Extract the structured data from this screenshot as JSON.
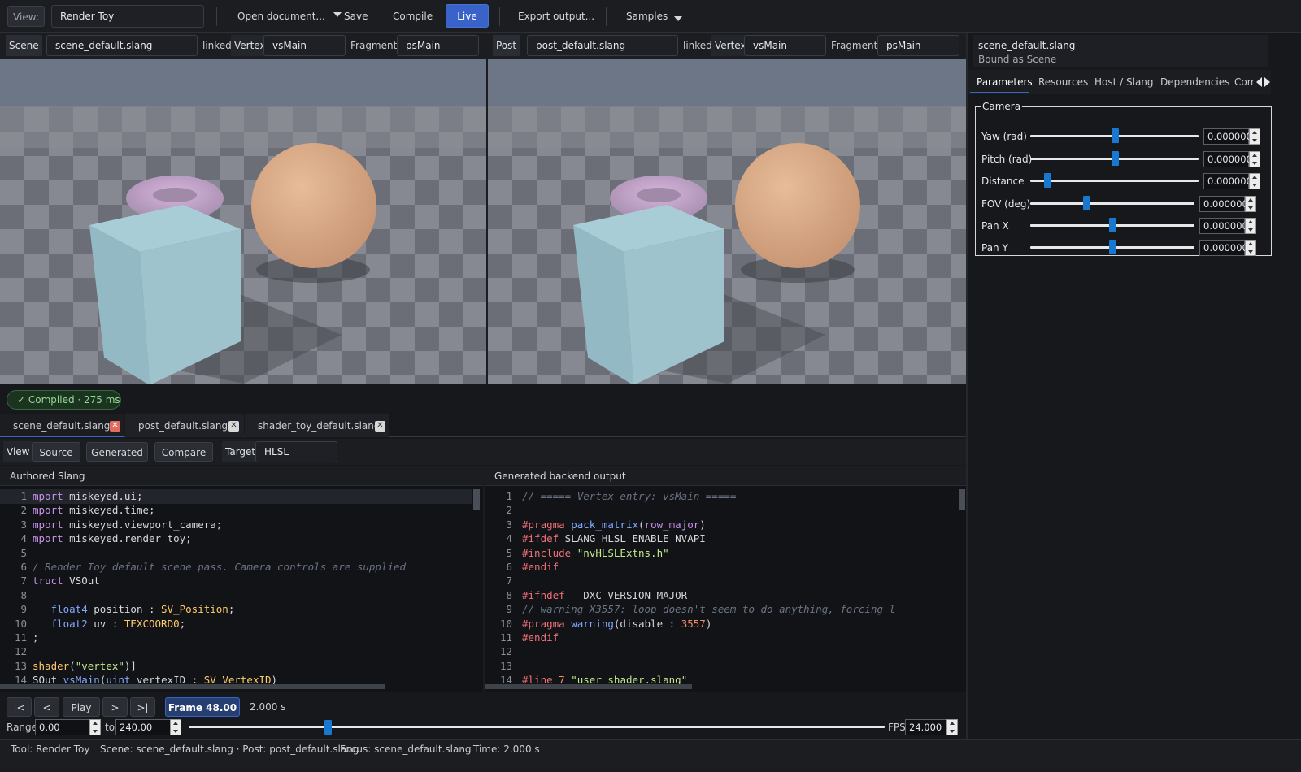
{
  "toolbar": {
    "view_label": "View:",
    "view_value": "Render Toy",
    "open_document": "Open document...",
    "save": "Save",
    "compile": "Compile",
    "live": "Live",
    "export_output": "Export output...",
    "samples": "Samples"
  },
  "scene_bar": {
    "tag": "Scene",
    "file": "scene_default.slang",
    "linked": "linked",
    "vertex_label": "Vertex",
    "vertex_value": "vsMain",
    "fragment_label": "Fragment",
    "fragment_value": "psMain"
  },
  "post_bar": {
    "tag": "Post",
    "file": "post_default.slang",
    "linked": "linked",
    "vertex_label": "Vertex",
    "vertex_value": "vsMain",
    "fragment_label": "Fragment",
    "fragment_value": "psMain"
  },
  "status_badge": "✓  Compiled · 275 ms",
  "doc_tabs": [
    {
      "label": "scene_default.slang",
      "active": true
    },
    {
      "label": "post_default.slang",
      "active": false
    },
    {
      "label": "shader_toy_default.slang",
      "active": false
    }
  ],
  "view_bar": {
    "view_label": "View",
    "source": "Source",
    "generated": "Generated",
    "compare": "Compare",
    "target_label": "Target",
    "target_value": "HLSL"
  },
  "left_pane_title": "Authored Slang",
  "right_pane_title": "Generated backend output",
  "left_line_numbers": [
    "1",
    "2",
    "3",
    "4",
    "5",
    "6",
    "7",
    "8",
    "9",
    "10",
    "11",
    "12",
    "13",
    "14"
  ],
  "right_line_numbers": [
    "1",
    "2",
    "3",
    "4",
    "5",
    "6",
    "7",
    "8",
    "9",
    "10",
    "11",
    "12",
    "13",
    "14"
  ],
  "right_panel": {
    "file": "scene_default.slang",
    "bound_as": "Bound as Scene",
    "tabs": [
      "Parameters",
      "Resources",
      "Host / Slang",
      "Dependencies",
      "Com"
    ],
    "group_title": "Camera",
    "params": [
      {
        "label": "Yaw (rad)",
        "value": "0.000000",
        "level": 0.5
      },
      {
        "label": "Pitch (rad)",
        "value": "0.000000",
        "level": 0.5
      },
      {
        "label": "Distance",
        "value": "0.000000",
        "level": 0.1
      },
      {
        "label": "FOV (deg)",
        "value": "0.000000",
        "level": 0.34
      },
      {
        "label": "Pan X",
        "value": "0.000000",
        "level": 0.5
      },
      {
        "label": "Pan Y",
        "value": "0.000000",
        "level": 0.5
      }
    ]
  },
  "timeline": {
    "first": "|<",
    "prev": "<",
    "play": "Play",
    "next": ">",
    "last": ">|",
    "frame": "Frame 48.00",
    "time": "2.000 s",
    "range_label": "Range",
    "range_start": "0.00",
    "to_label": "to",
    "range_end": "240.00",
    "fps_label": "FPS",
    "fps_value": "24.000",
    "position": 0.2
  },
  "status_bar": {
    "tool": "Tool: Render Toy",
    "scene_post": "Scene: scene_default.slang · Post: post_default.slang",
    "focus": "Focus: scene_default.slang",
    "time": "Time: 2.000 s"
  },
  "colors": {
    "accent": "#3a63c9",
    "success": "#7ccf7a",
    "slider": "#1878d0"
  }
}
